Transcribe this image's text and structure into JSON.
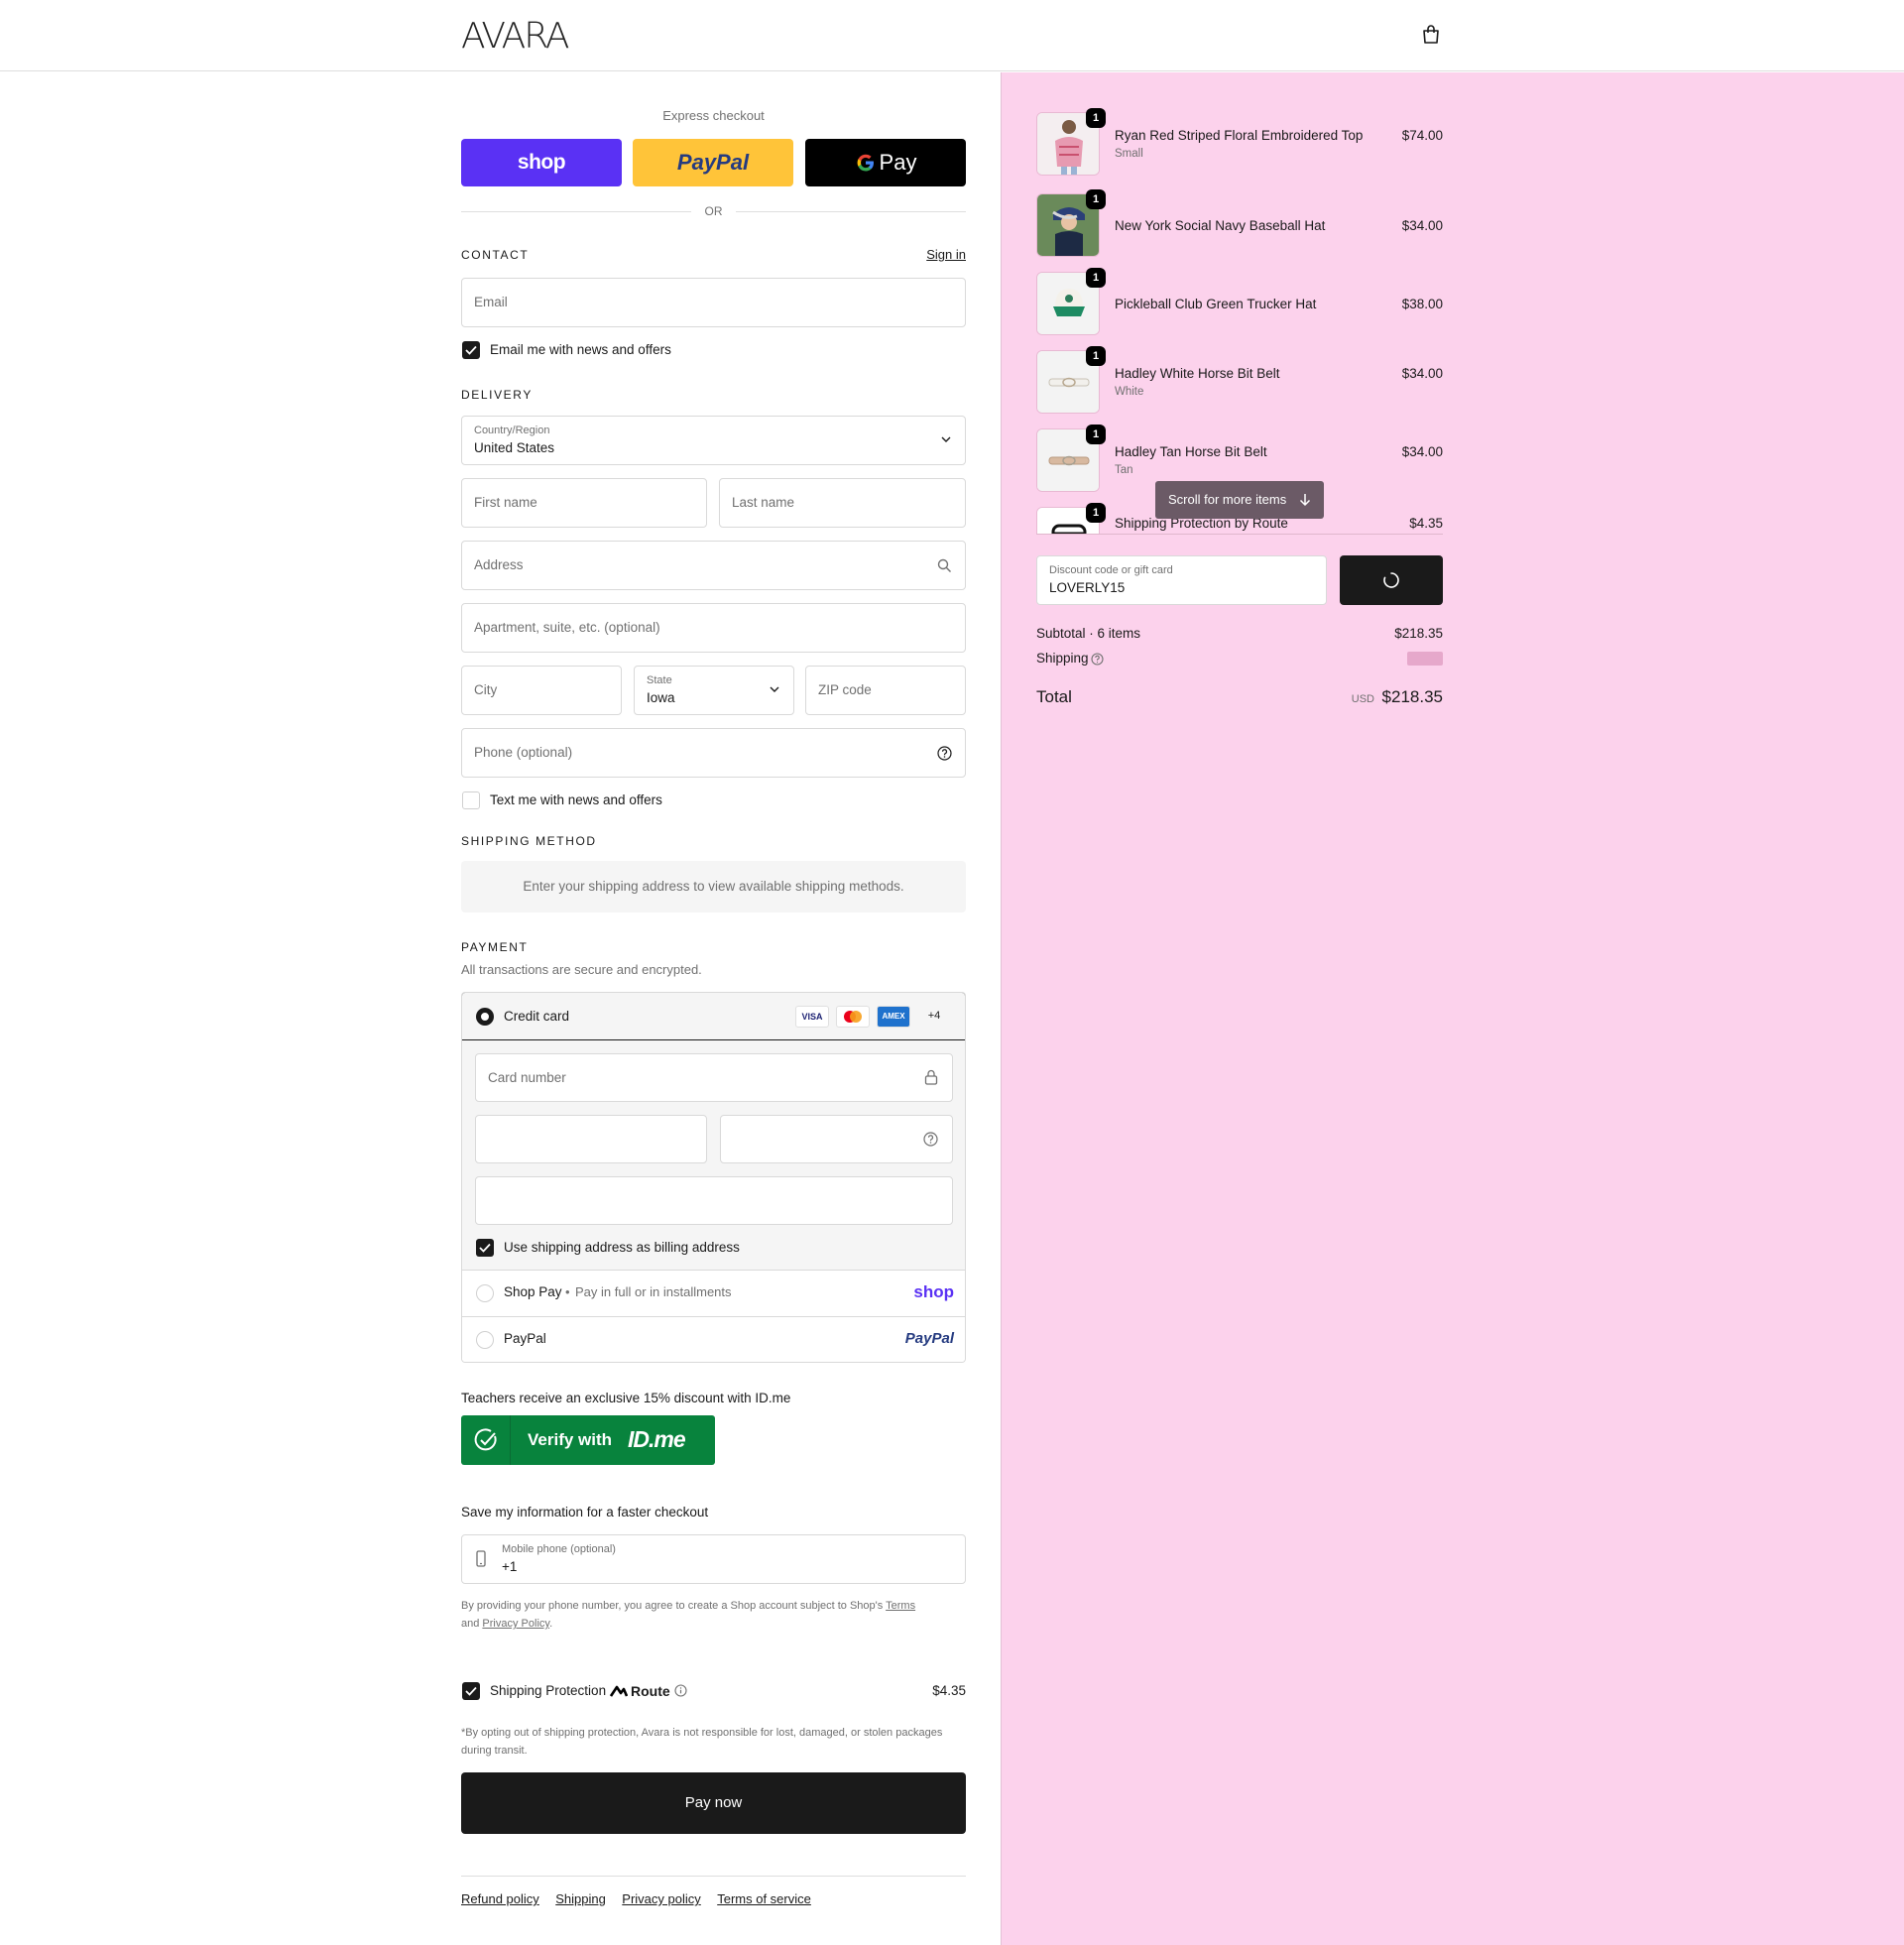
{
  "header": {
    "brand": "AVARA",
    "cart_icon": "shopping-bag-icon"
  },
  "express": {
    "title": "Express checkout",
    "shop_label": "shop",
    "paypal_label": "PayPal",
    "gpay_label": "Pay",
    "or_label": "OR"
  },
  "contact": {
    "title": "Contact",
    "sign_in": "Sign in",
    "email_placeholder": "Email",
    "news_label": "Email me with news and offers"
  },
  "delivery": {
    "title": "Delivery",
    "country_label": "Country/Region",
    "country_value": "United States",
    "first_name_placeholder": "First name",
    "last_name_placeholder": "Last name",
    "address_placeholder": "Address",
    "apartment_placeholder": "Apartment, suite, etc. (optional)",
    "city_placeholder": "City",
    "state_label": "State",
    "state_value": "Iowa",
    "zip_placeholder": "ZIP code",
    "phone_placeholder": "Phone (optional)",
    "text_label": "Text me with news and offers"
  },
  "shipping_method": {
    "title": "Shipping method",
    "message": "Enter your shipping address to view available shipping methods."
  },
  "payment": {
    "title": "Payment",
    "subtitle": "All transactions are secure and encrypted.",
    "credit_card_label": "Credit card",
    "card_brands": [
      "VISA",
      "",
      "AMEX",
      "+4"
    ],
    "card_number_placeholder": "Card number",
    "billing_label": "Use shipping address as billing address",
    "shop_pay_label": "Shop Pay",
    "shop_pay_sub": "Pay in full or in installments",
    "shop_pay_logo": "shop",
    "paypal_label": "PayPal",
    "paypal_logo": "PayPal"
  },
  "idme": {
    "text": "Teachers receive an exclusive 15% discount with ID.me",
    "button_prefix": "Verify with",
    "button_brand": "ID.me"
  },
  "save_info": {
    "title": "Save my information for a faster checkout",
    "mobile_label": "Mobile phone (optional)",
    "mobile_value": "+1",
    "legal_prefix": "By providing your phone number, you agree to create a Shop account subject to Shop's",
    "terms": "Terms",
    "and": "and",
    "privacy": "Privacy Policy"
  },
  "protection": {
    "label": "Shipping Protection",
    "brand": "Route",
    "price": "$4.35",
    "note": "*By opting out of shipping protection, Avara is not responsible for lost, damaged, or stolen packages during transit."
  },
  "pay_now": "Pay now",
  "footer": [
    "Refund policy",
    "Shipping",
    "Privacy policy",
    "Terms of service"
  ],
  "summary": {
    "items": [
      {
        "name": "Ryan Red Striped Floral Embroidered Top",
        "variant": "Small",
        "price": "$74.00",
        "qty": "1"
      },
      {
        "name": "New York Social Navy Baseball Hat",
        "variant": "",
        "price": "$34.00",
        "qty": "1"
      },
      {
        "name": "Pickleball Club Green Trucker Hat",
        "variant": "",
        "price": "$38.00",
        "qty": "1"
      },
      {
        "name": "Hadley White Horse Bit Belt",
        "variant": "White",
        "price": "$34.00",
        "qty": "1"
      },
      {
        "name": "Hadley Tan Horse Bit Belt",
        "variant": "Tan",
        "price": "$34.00",
        "qty": "1"
      },
      {
        "name": "Shipping Protection by Route",
        "variant": "",
        "price": "$4.35",
        "qty": "1"
      }
    ],
    "scroll_label": "Scroll for more items",
    "discount_label": "Discount code or gift card",
    "discount_value": "LOVERLY15",
    "subtotal_label": "Subtotal · 6 items",
    "subtotal_value": "$218.35",
    "shipping_label": "Shipping",
    "total_label": "Total",
    "currency": "USD",
    "total_value": "$218.35"
  }
}
